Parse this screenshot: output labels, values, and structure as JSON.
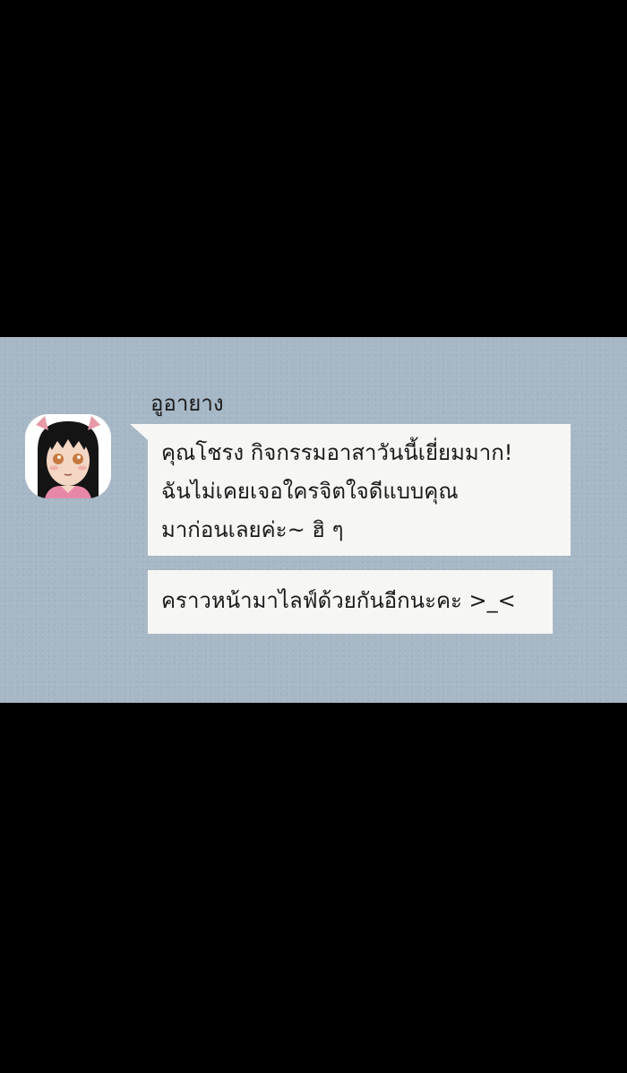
{
  "chat": {
    "sender_name": "อูอายาง",
    "avatar_icon": "girl-avatar-icon",
    "messages": [
      {
        "lines": [
          "คุณโชรง กิจกรรมอาสาวันนี้เยี่ยมมาก!",
          "ฉันไม่เคยเจอใครจิตใจดีแบบคุณ",
          "มาก่อนเลยค่ะ~ ฮิ ๆ"
        ]
      },
      {
        "lines": [
          "คราวหน้ามาไลฟ์ด้วยกันอีกนะคะ >_<"
        ]
      }
    ]
  },
  "colors": {
    "page_background": "#000000",
    "chat_background": "#a6b7c6",
    "bubble": "#f6f6f4",
    "text": "#1a1a1a"
  }
}
